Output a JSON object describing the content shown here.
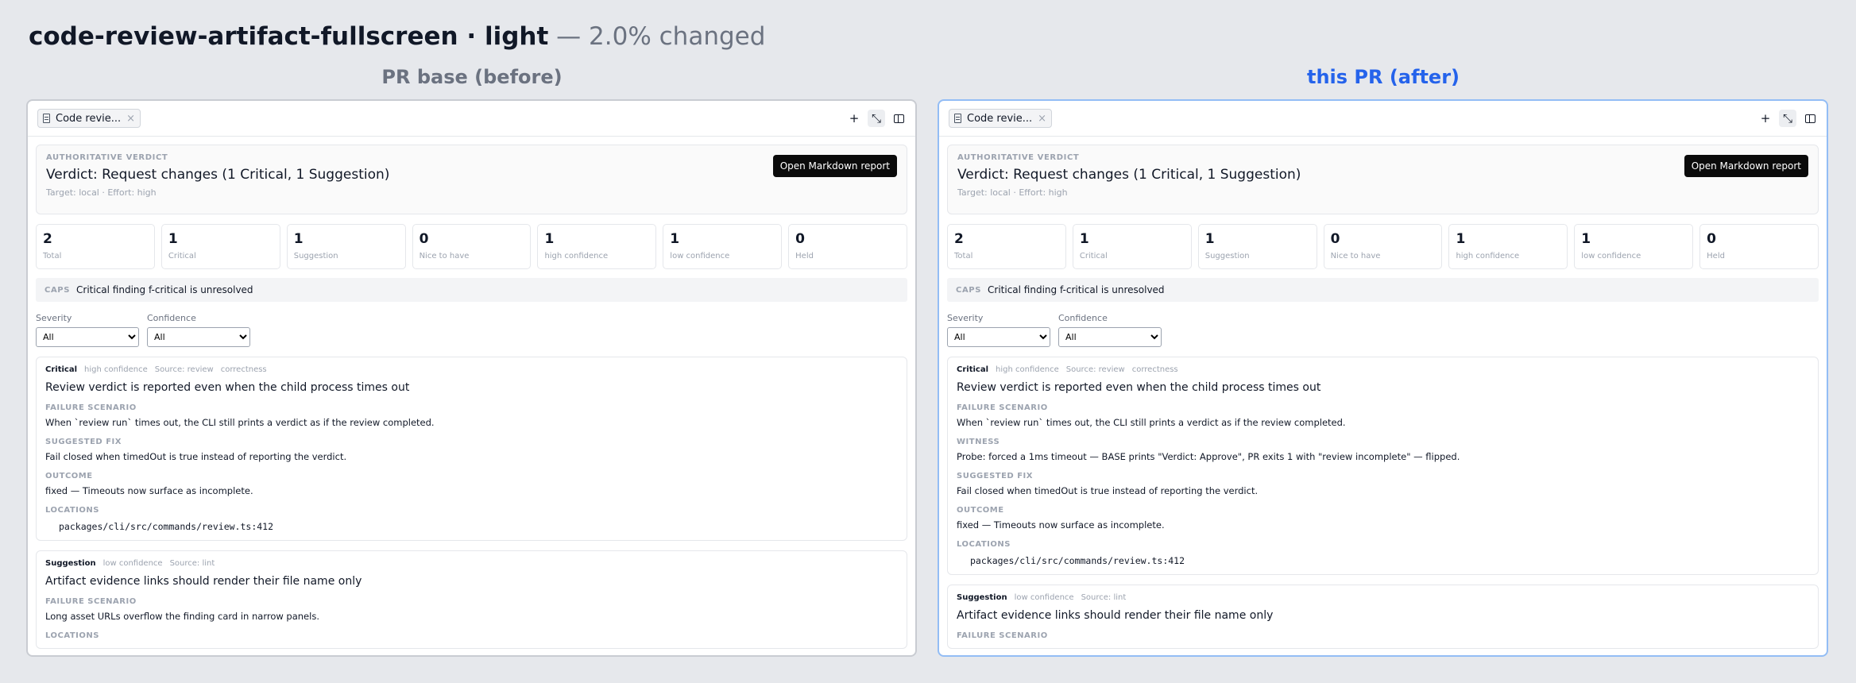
{
  "header": {
    "title": "code-review-artifact-fullscreen · light",
    "separator": " — ",
    "changed": "2.0% changed"
  },
  "columns": {
    "before_label": "PR base (before)",
    "after_label": "this PR (after)"
  },
  "tab": {
    "label": "Code revie...",
    "close": "×",
    "add": "+",
    "collapse": "⤡"
  },
  "verdict": {
    "eyebrow": "AUTHORITATIVE VERDICT",
    "text": "Verdict: Request changes (1 Critical, 1 Suggestion)",
    "target": "Target: local · Effort: high",
    "button": "Open Markdown report"
  },
  "stats": [
    {
      "num": "2",
      "label": "Total"
    },
    {
      "num": "1",
      "label": "Critical"
    },
    {
      "num": "1",
      "label": "Suggestion"
    },
    {
      "num": "0",
      "label": "Nice to have"
    },
    {
      "num": "1",
      "label": "high confidence"
    },
    {
      "num": "1",
      "label": "low confidence"
    },
    {
      "num": "0",
      "label": "Held"
    }
  ],
  "caps": {
    "tag": "CAPS",
    "text": "Critical finding f-critical is unresolved"
  },
  "filters": {
    "severity_label": "Severity",
    "severity_value": "All",
    "confidence_label": "Confidence",
    "confidence_value": "All"
  },
  "finding1": {
    "severity": "Critical",
    "confidence": "high confidence",
    "source": "Source: review",
    "category": "correctness",
    "title": "Review verdict is reported even when the child process times out",
    "failure_h": "FAILURE SCENARIO",
    "failure_b": "When `review run` times out, the CLI still prints a verdict as if the review completed.",
    "witness_h": "WITNESS",
    "witness_b": "Probe: forced a 1ms timeout — BASE prints \"Verdict: Approve\", PR exits 1 with \"review incomplete\" — flipped.",
    "fix_h": "SUGGESTED FIX",
    "fix_b": "Fail closed when timedOut is true instead of reporting the verdict.",
    "outcome_h": "OUTCOME",
    "outcome_b": "fixed — Timeouts now surface as incomplete.",
    "loc_h": "LOCATIONS",
    "loc_b": "packages/cli/src/commands/review.ts:412"
  },
  "finding2": {
    "severity": "Suggestion",
    "confidence": "low confidence",
    "source": "Source: lint",
    "title": "Artifact evidence links should render their file name only",
    "failure_h": "FAILURE SCENARIO",
    "failure_b": "Long asset URLs overflow the finding card in narrow panels.",
    "loc_h": "LOCATIONS"
  }
}
